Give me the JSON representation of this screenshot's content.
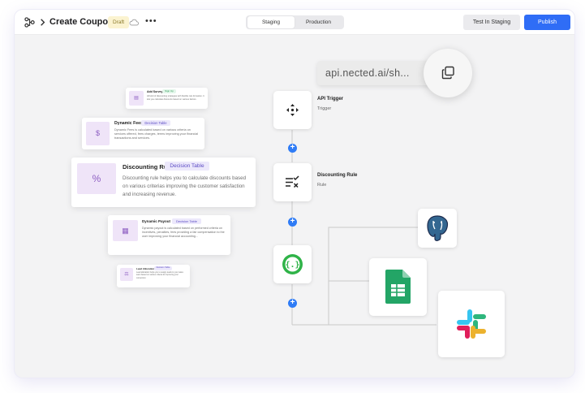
{
  "header": {
    "title": "Create Coupon",
    "badge": "Draft",
    "more": "•••",
    "env_tabs": [
      "Staging",
      "Production"
    ],
    "active_env": "Staging",
    "test_label": "Test In Staging",
    "publish_label": "Publish",
    "publish_color": "#2f6df6"
  },
  "api_url": "api.nected.ai/sh...",
  "flow": {
    "nodes": [
      {
        "label": "API Trigger",
        "sub": "Trigger",
        "icon": "move-arrows-icon"
      },
      {
        "label": "Discounting Rule",
        "sub": "Rule",
        "icon": "rule-list-icon"
      },
      {
        "label": "",
        "sub": "",
        "icon": "code-braces-icon"
      }
    ],
    "integrations": [
      "postgresql-icon",
      "google-sheets-icon",
      "slack-icon"
    ]
  },
  "cards": [
    {
      "title": "Add Survey",
      "tag": "Sign Up",
      "desc": "All kind of discounting strategies with flexible rule formation. It lets you calculate discounts based on various factors."
    },
    {
      "title": "Dynamic Fees",
      "tag": "Decision Table",
      "desc": "Dynamic Fees is calculated based on various criteria on services offered, fees charges, terms improving your financial transactions and services."
    },
    {
      "title": "Discounting Rule",
      "tag": "Decision Table",
      "desc": "Discounting rule helps you to calculate discounts based on various criterias improving the customer satisfaction and increasing revenue."
    },
    {
      "title": "Dynamic Payout",
      "tag": "Decision Table",
      "desc": "Dynamic payout is calculated based on performed criteria on incentives, penalties, fees providing a fair compensation to the user improving your financial accounting..."
    },
    {
      "title": "Lead Allocation",
      "tag": "Decision Table",
      "desc": "Lead allocation helps you to assign leads to your sales team based on various criteria for improving your conversion."
    }
  ]
}
